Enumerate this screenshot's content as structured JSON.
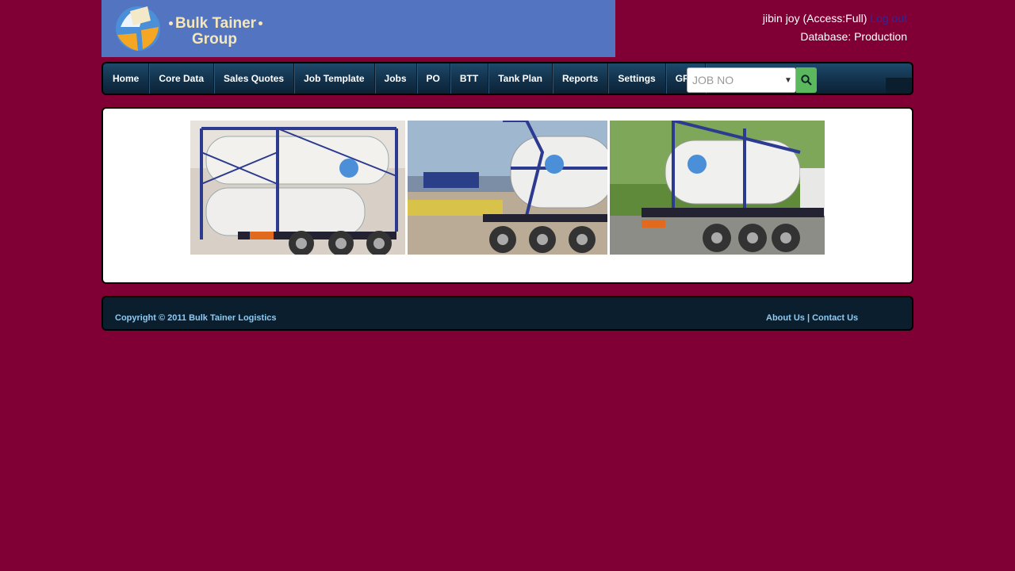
{
  "brand": {
    "line1": "Bulk Tainer",
    "line2": "Group"
  },
  "user": {
    "info": "jibin joy (Access:Full)",
    "logout": "Log out",
    "database": "Database: Production"
  },
  "nav": {
    "items": [
      "Home",
      "Core Data",
      "Sales Quotes",
      "Job Template",
      "Jobs",
      "PO",
      "BTT",
      "Tank Plan",
      "Reports",
      "Settings",
      "GPS"
    ],
    "search_select": "JOB NO"
  },
  "footer": {
    "copyright": "Copyright © 2011 Bulk Tainer Logistics",
    "about": "About Us",
    "separator": "|",
    "contact": "Contact Us"
  },
  "photos": {
    "brand_text": "Bulk Tainer Logistics"
  },
  "colors": {
    "background": "#800036",
    "header": "#5374c1",
    "nav": "#143550",
    "search_button": "#5cb85c",
    "footer_link": "#8ecbf2"
  }
}
